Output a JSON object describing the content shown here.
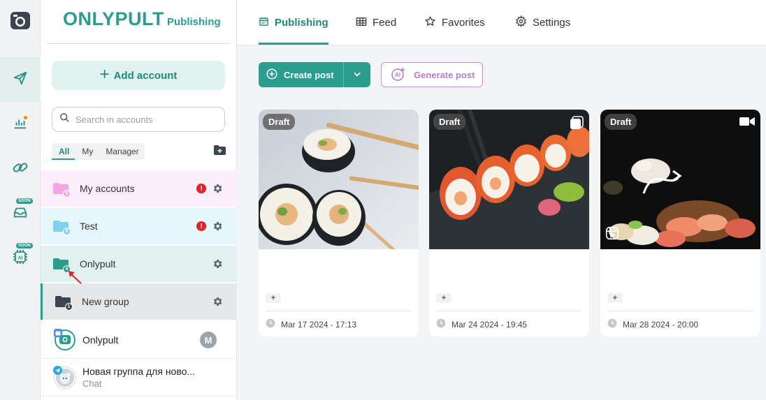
{
  "brand": {
    "name": "ONLYPULT",
    "subtitle": "Publishing"
  },
  "rail": {
    "items": [
      {
        "icon": "camera-logo-icon"
      },
      {
        "icon": "send-icon",
        "active": true
      },
      {
        "icon": "analytics-icon",
        "dot": true
      },
      {
        "icon": "link-icon"
      },
      {
        "icon": "inbox-icon",
        "badge": "SOON"
      },
      {
        "icon": "ai-chip-icon",
        "badge": "SOON"
      }
    ]
  },
  "sidebar": {
    "add_account_label": "Add account",
    "search_placeholder": "Search in accounts",
    "filter_tabs": [
      "All",
      "My",
      "Manager"
    ],
    "groups": [
      {
        "label": "My accounts",
        "count": "5",
        "alert": "!",
        "color": "#f3a6e4",
        "bg": "#fdeefc"
      },
      {
        "label": "Test",
        "count": "6",
        "alert": "!",
        "color": "#7fd0ea",
        "bg": "#e6f7fc"
      },
      {
        "label": "Onlypult",
        "count": "4",
        "color": "#2a9d8f",
        "bg": "#e0f1ee"
      },
      {
        "label": "New group",
        "count": "1",
        "color": "#3d4550",
        "bg": "#e6e7e9"
      }
    ],
    "accounts": [
      {
        "name": "Onlypult",
        "sub": "",
        "manager": "M"
      },
      {
        "name": "Новая группа для ново...",
        "sub": "Chat"
      }
    ]
  },
  "topnav": {
    "tabs": [
      {
        "label": "Publishing",
        "icon": "calendar-icon",
        "active": true
      },
      {
        "label": "Feed",
        "icon": "grid-icon"
      },
      {
        "label": "Favorites",
        "icon": "star-icon"
      },
      {
        "label": "Settings",
        "icon": "gear-icon"
      }
    ]
  },
  "toolbar": {
    "create_label": "Create post",
    "generate_label": "Generate post"
  },
  "posts": [
    {
      "status": "Draft",
      "plus": "+",
      "date": "Mar 17 2024 - 17:13",
      "type": ""
    },
    {
      "status": "Draft",
      "plus": "+",
      "date": "Mar 24 2024 - 19:45",
      "type": "gallery-icon"
    },
    {
      "status": "Draft",
      "plus": "+",
      "date": "Mar 28 2024 - 20:00",
      "type": "video-icon"
    }
  ],
  "colors": {
    "accent": "#2a9d8f",
    "purple": "#b97ccd",
    "alert": "#e5222b"
  }
}
